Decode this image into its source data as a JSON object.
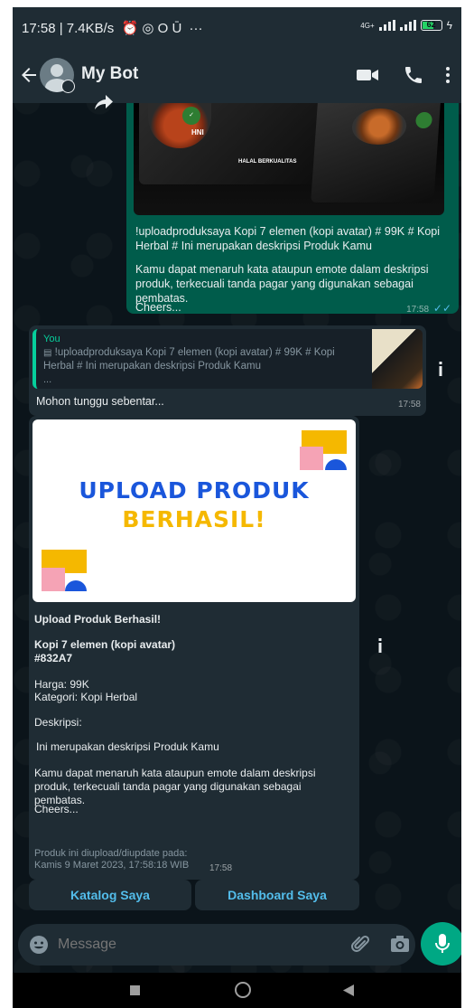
{
  "status_bar": {
    "time_speed": "17:58 | 7.4KB/s",
    "more": "···",
    "network": "4G+",
    "battery": "62"
  },
  "header": {
    "title": "My Bot"
  },
  "message_out": {
    "text1": "!uploadproduksaya Kopi 7 elemen (kopi avatar) # 99K # Kopi Herbal # Ini merupakan deskripsi Produk Kamu",
    "text2": "Kamu dapat menaruh kata ataupun emote dalam deskripsi produk, terkecuali tanda pagar yang digunakan sebagai pembatas.",
    "text3": "Cheers...",
    "time": "17:58",
    "image_texts": {
      "halal": "HALAL BERKUALITAS",
      "brand": "HNI"
    }
  },
  "message_reply": {
    "quote_author": "You",
    "quote_text": "!uploadproduksaya Kopi 7 elemen (kopi avatar) # 99K # Kopi Herbal # Ini merupakan deskripsi Produk Kamu",
    "quote_more": "...",
    "text": "Mohon tunggu sebentar...",
    "time": "17:58"
  },
  "message_result": {
    "card_line1": "UPLOAD PRODUK",
    "card_line2": "BERHASIL!",
    "heading": "Upload Produk Berhasil!",
    "product_name": "Kopi 7 elemen (kopi avatar)",
    "product_code": "#832A7",
    "price": "Harga: 99K",
    "category": "Kategori: Kopi Herbal",
    "desc_label": "Deskripsi:",
    "desc": "Ini merupakan deskripsi Produk Kamu",
    "note": "Kamu dapat menaruh kata ataupun emote dalam deskripsi produk, terkecuali tanda pagar yang digunakan sebagai pembatas.",
    "cheers": "Cheers...",
    "footer_line1": "Produk ini diupload/diupdate pada:",
    "footer_line2": "Kamis 9 Maret 2023, 17:58:18 WIB",
    "time": "17:58"
  },
  "buttons": {
    "katalog": "Katalog Saya",
    "dashboard": "Dashboard Saya"
  },
  "composer": {
    "placeholder": "Message"
  },
  "colors": {
    "outgoing": "#005c4b",
    "incoming": "#1f2c34",
    "accent": "#00a884",
    "link": "#53bdeb"
  }
}
